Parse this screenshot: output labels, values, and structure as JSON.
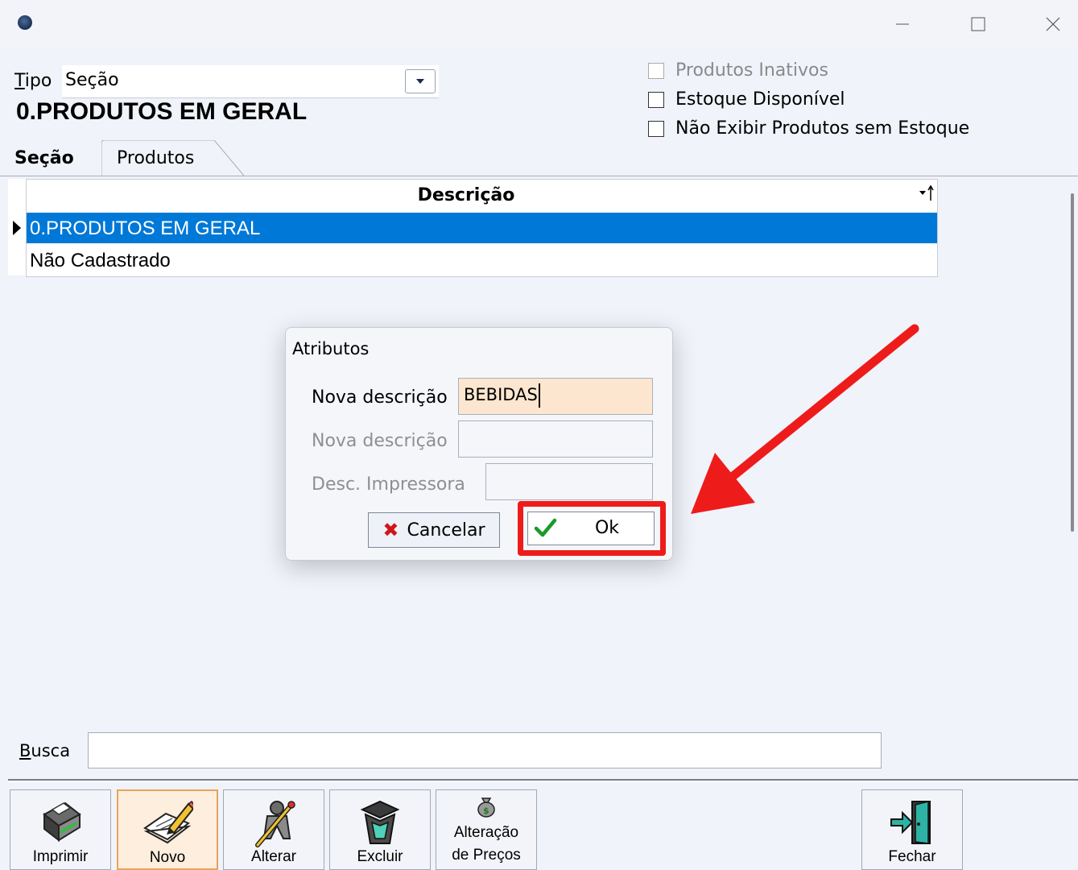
{
  "window": {
    "minimize_glyph": "—",
    "maximize_glyph": "☐",
    "close_glyph": "✕"
  },
  "tipo": {
    "label_underlined": "T",
    "label_rest": "ipo",
    "value": "Seção"
  },
  "section_title": "0.PRODUTOS EM GERAL",
  "filters": [
    {
      "label": "Produtos Inativos",
      "checked": false,
      "disabled": true
    },
    {
      "label": "Estoque Disponível",
      "checked": false,
      "disabled": false
    },
    {
      "label": "Não Exibir Produtos sem Estoque",
      "checked": false,
      "disabled": false
    }
  ],
  "tabs": [
    {
      "label": "Seção",
      "active": true
    },
    {
      "label": "Produtos",
      "active": false
    }
  ],
  "grid": {
    "header": "Descrição",
    "sort_glyph": "↾",
    "rows": [
      {
        "text": "0.PRODUTOS EM GERAL",
        "selected": true
      },
      {
        "text": "Não Cadastrado",
        "selected": false
      }
    ]
  },
  "dialog": {
    "title": "Atributos",
    "field1_label": "Nova descrição",
    "field1_value": "BEBIDAS",
    "field2_label": "Nova descrição",
    "field2_value": "",
    "field3_label": "Desc. Impressora",
    "field3_value": "",
    "cancel_label": "Cancelar",
    "ok_label": "Ok"
  },
  "busca": {
    "label_underlined": "B",
    "label_rest": "usca",
    "value": ""
  },
  "toolbar": [
    {
      "name": "imprimir",
      "label": "Imprimir",
      "icon": "printer-icon"
    },
    {
      "name": "novo",
      "label": "Novo",
      "icon": "new-document-pencil-icon"
    },
    {
      "name": "alterar",
      "label": "Alterar",
      "icon": "edit-person-icon"
    },
    {
      "name": "excluir",
      "label": "Excluir",
      "icon": "trash-bin-icon"
    },
    {
      "name": "precos",
      "label_line1": "Alteração",
      "label_line2": "de Preços",
      "icon": "money-bag-icon"
    },
    {
      "name": "fechar",
      "label": "Fechar",
      "icon": "exit-door-icon"
    }
  ],
  "colors": {
    "selection": "#0078d7",
    "highlight": "#ee1b1b",
    "field_active": "#fde6cf",
    "cancel_x": "#d0161a",
    "ok_check": "#1a9a2a"
  }
}
